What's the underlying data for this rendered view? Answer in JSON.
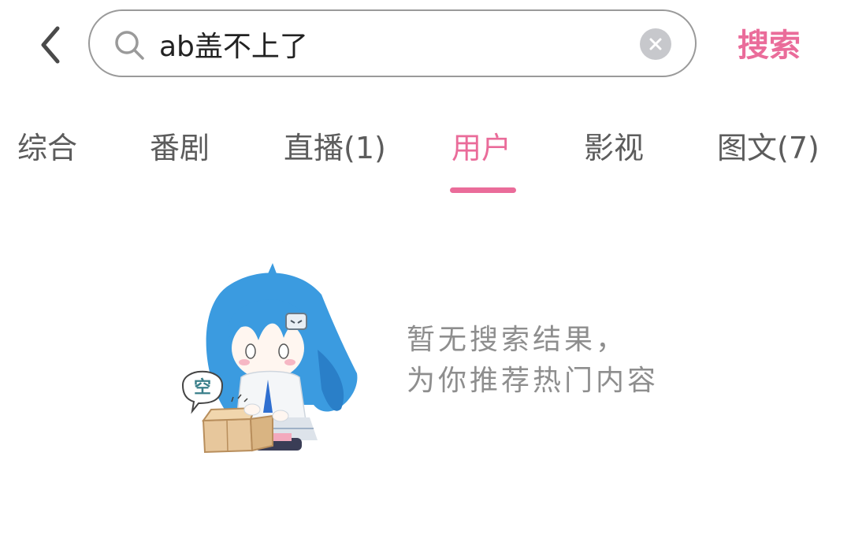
{
  "header": {
    "back_icon": "chevron-left-icon",
    "search_icon": "search-icon",
    "search_value": "ab盖不上了",
    "clear_icon": "clear-x-icon",
    "search_button_label": "搜索",
    "accent_color": "#ea6c9a"
  },
  "tabs": [
    {
      "label": "综合",
      "active": false
    },
    {
      "label": "番剧",
      "active": false
    },
    {
      "label": "直播(1)",
      "active": false
    },
    {
      "label": "用户",
      "active": true
    },
    {
      "label": "影视",
      "active": false
    },
    {
      "label": "图文(7)",
      "active": false
    }
  ],
  "empty_state": {
    "illustration_label": "空",
    "line1": "暂无搜索结果，",
    "line2": "为你推荐热门内容"
  }
}
